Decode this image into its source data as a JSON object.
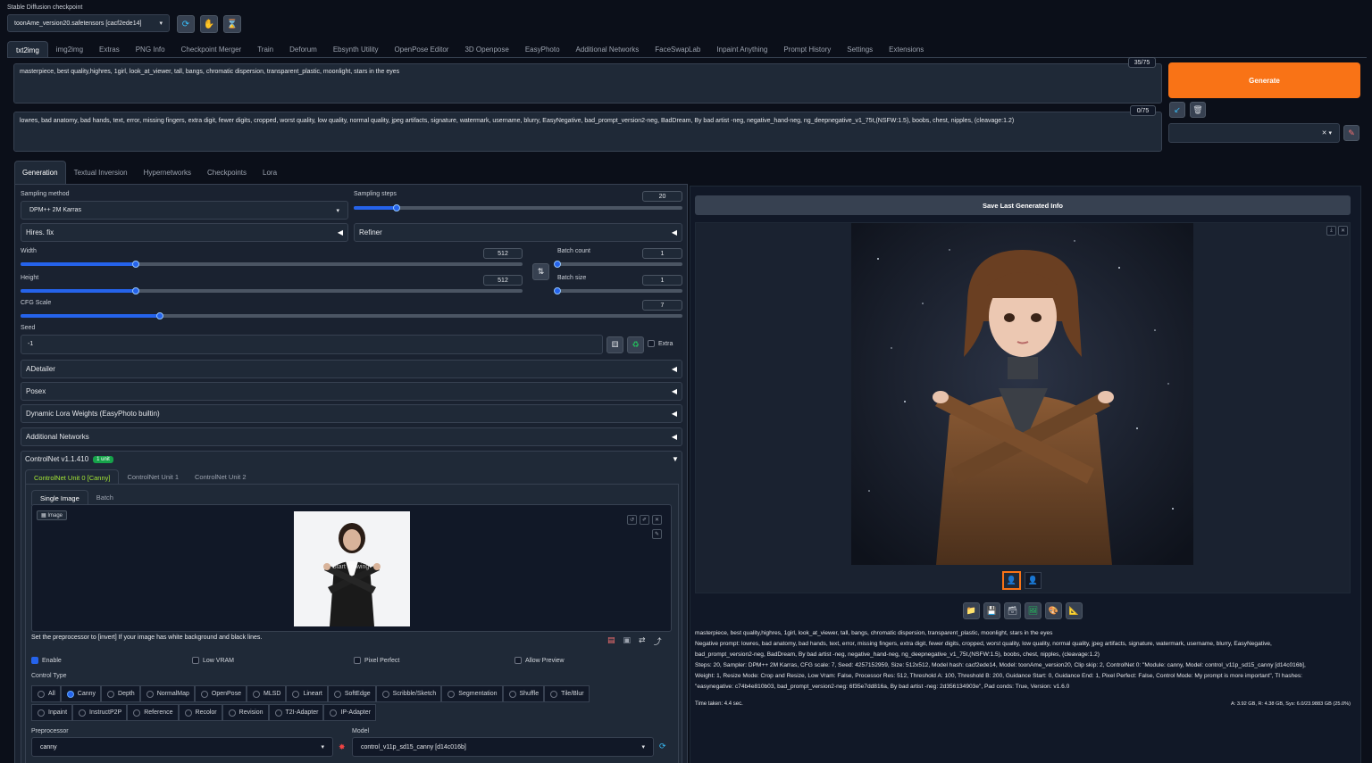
{
  "checkpoint": {
    "label": "Stable Diffusion checkpoint",
    "value": "toonAme_version20.safetensors [cacf2ede14]"
  },
  "main_tabs": [
    "txt2img",
    "img2img",
    "Extras",
    "PNG Info",
    "Checkpoint Merger",
    "Train",
    "Deforum",
    "Ebsynth Utility",
    "OpenPose Editor",
    "3D Openpose",
    "EasyPhoto",
    "Additional Networks",
    "FaceSwapLab",
    "Inpaint Anything",
    "Prompt History",
    "Settings",
    "Extensions"
  ],
  "prompt": {
    "text": "masterpiece, best quality,highres, 1girl, look_at_viewer, tall, bangs, chromatic dispersion, transparent_plastic, moonlight, stars in the eyes",
    "count": "35/75"
  },
  "negative_prompt": {
    "text": "lowres, bad anatomy, bad hands, text, error, missing fingers, extra digit, fewer digits, cropped, worst quality, low quality, normal quality, jpeg artifacts, signature, watermark, username, blurry, EasyNegative, bad_prompt_version2-neg, BadDream, By bad artist -neg, negative_hand-neg, ng_deepnegative_v1_75t,(NSFW:1.5), boobs, chest, nipples, (cleavage:1.2)",
    "count": "0/75"
  },
  "generate_label": "Generate",
  "sub_tabs": [
    "Generation",
    "Textual Inversion",
    "Hypernetworks",
    "Checkpoints",
    "Lora"
  ],
  "sampling": {
    "method_label": "Sampling method",
    "method_value": "DPM++ 2M Karras",
    "steps_label": "Sampling steps",
    "steps_value": "20",
    "steps_fraction": 0.13
  },
  "hires_label": "Hires. fix",
  "refiner_label": "Refiner",
  "width": {
    "label": "Width",
    "value": "512",
    "fraction": 0.23
  },
  "height": {
    "label": "Height",
    "value": "512",
    "fraction": 0.23
  },
  "batch_count": {
    "label": "Batch count",
    "value": "1",
    "fraction": 0.0
  },
  "batch_size": {
    "label": "Batch size",
    "value": "1",
    "fraction": 0.0
  },
  "cfg": {
    "label": "CFG Scale",
    "value": "7",
    "fraction": 0.21
  },
  "seed": {
    "label": "Seed",
    "value": "-1",
    "extra_label": "Extra"
  },
  "accordions": [
    "ADetailer",
    "Posex",
    "Dynamic Lora Weights (EasyPhoto builtin)",
    "Additional Networks"
  ],
  "controlnet": {
    "title": "ControlNet v1.1.410",
    "badge": "1 unit",
    "units": [
      "ControlNet Unit 0 [Canny]",
      "ControlNet Unit 1",
      "ControlNet Unit 2"
    ],
    "image_tabs": [
      "Single Image",
      "Batch"
    ],
    "image_label": "Image",
    "watermark": "Start drawing",
    "hint": "Set the preprocessor to [invert] If your image has white background and black lines.",
    "checks": [
      {
        "label": "Enable",
        "checked": true
      },
      {
        "label": "Low VRAM",
        "checked": false
      },
      {
        "label": "Pixel Perfect",
        "checked": false
      },
      {
        "label": "Allow Preview",
        "checked": false
      }
    ],
    "control_type_label": "Control Type",
    "types_row1": [
      "All",
      "Canny",
      "Depth",
      "NormalMap",
      "OpenPose",
      "MLSD",
      "Lineart",
      "SoftEdge",
      "Scribble/Sketch",
      "Segmentation",
      "Shuffle",
      "Tile/Blur"
    ],
    "types_row2": [
      "Inpaint",
      "InstructP2P",
      "Reference",
      "Recolor",
      "Revision",
      "T2I-Adapter",
      "IP-Adapter"
    ],
    "selected_type": "Canny",
    "preprocessor_label": "Preprocessor",
    "preprocessor_value": "canny",
    "model_label": "Model",
    "model_value": "control_v11p_sd15_canny [d14c016b]"
  },
  "output": {
    "save_label": "Save Last Generated Info",
    "info_lines": [
      "masterpiece, best quality,highres, 1girl, look_at_viewer, tall, bangs, chromatic dispersion, transparent_plastic, moonlight, stars in the eyes",
      "Negative prompt: lowres, bad anatomy, bad hands, text, error, missing fingers, extra digit, fewer digits, cropped, worst quality, low quality, normal quality, jpeg artifacts, signature, watermark, username, blurry, EasyNegative,",
      "bad_prompt_version2-neg, BadDream, By bad artist -neg, negative_hand-neg, ng_deepnegative_v1_75t,(NSFW:1.5), boobs, chest, nipples, (cleavage:1.2)",
      "Steps: 20, Sampler: DPM++ 2M Karras, CFG scale: 7, Seed: 4257152959, Size: 512x512, Model hash: cacf2ede14, Model: toonAme_version20, Clip skip: 2, ControlNet 0: \"Module: canny, Model: control_v11p_sd15_canny [d14c016b],",
      "Weight: 1, Resize Mode: Crop and Resize, Low Vram: False, Processor Res: 512, Threshold A: 100, Threshold B: 200, Guidance Start: 0, Guidance End: 1, Pixel Perfect: False, Control Mode: My prompt is more important\", TI hashes:",
      "\"easynegative: c74b4e810b03, bad_prompt_version2-neg: 6f35e7dd816a, By bad artist -neg: 2d356134903e\", Pad conds: True, Version: v1.6.0"
    ],
    "time_taken": "Time taken: 4.4 sec.",
    "vram": "A: 3.92 GB, R: 4.38 GB, Sys: 6.0/23.9883 GB (25.0%)"
  }
}
